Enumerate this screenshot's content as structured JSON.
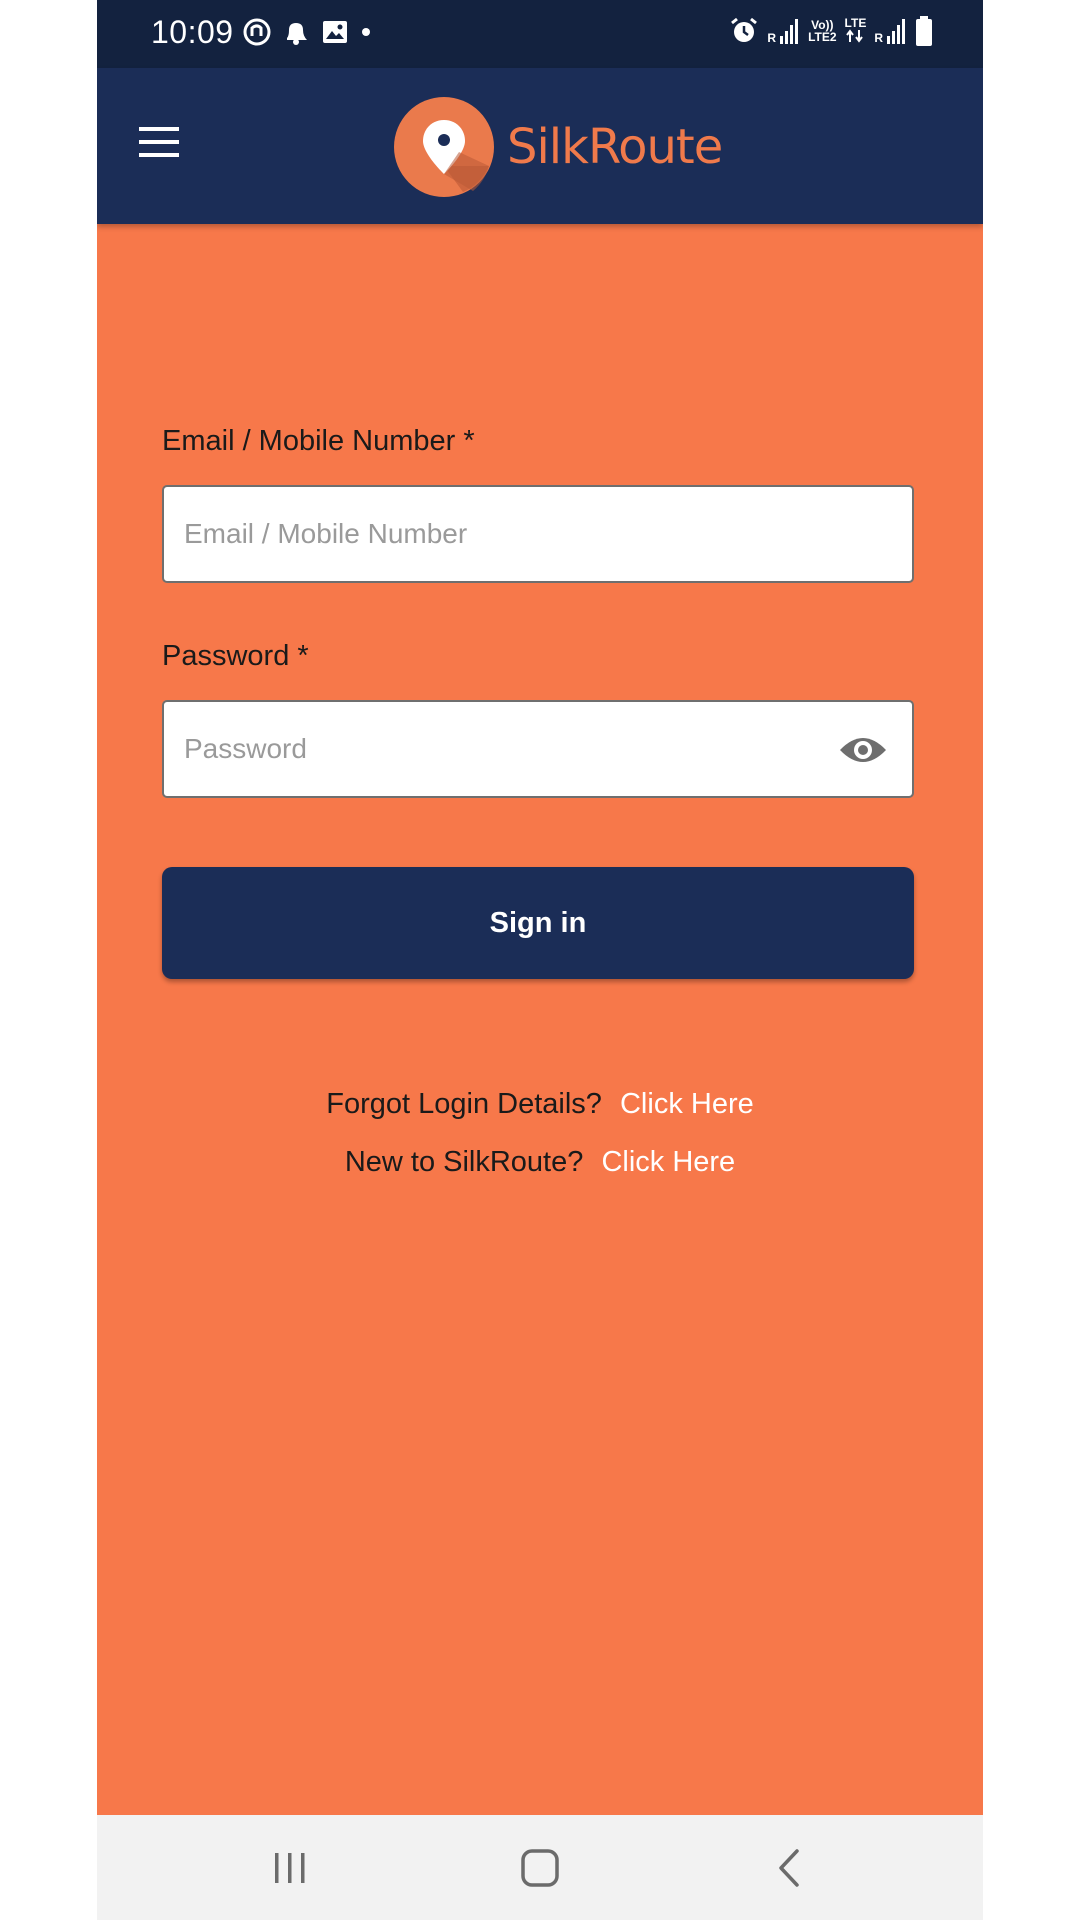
{
  "status_bar": {
    "time": "10:09",
    "network_1": {
      "top": "R",
      "bottom": ""
    },
    "network_volte": {
      "top": "Vo))",
      "bottom": "LTE2"
    },
    "network_2": {
      "top": "LTE",
      "bottom": ""
    },
    "network_3": {
      "top": "R",
      "bottom": ""
    }
  },
  "app_bar": {
    "brand_name": "SilkRoute"
  },
  "form": {
    "email": {
      "label": "Email / Mobile Number *",
      "placeholder": "Email / Mobile Number",
      "value": ""
    },
    "password": {
      "label": "Password *",
      "placeholder": "Password",
      "value": ""
    },
    "signin_label": "Sign in"
  },
  "links": {
    "forgot_question": "Forgot Login Details?",
    "forgot_link": "Click Here",
    "new_question": "New to SilkRoute?",
    "new_link": "Click Here"
  },
  "colors": {
    "background": "#f7784a",
    "navy": "#1b2d57",
    "status_bar": "#13223f",
    "brand_orange": "#f07a4b"
  }
}
